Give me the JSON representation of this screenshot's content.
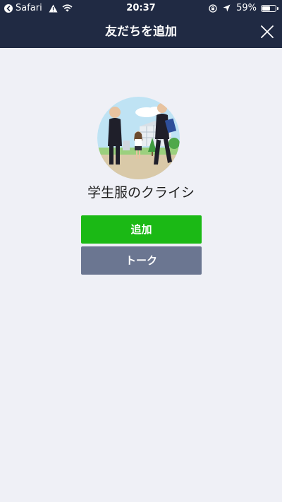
{
  "status_bar": {
    "back_app": "Safari",
    "time": "20:37",
    "battery_percent": "59%",
    "battery_level": 0.59,
    "icons": [
      "back-arrow-icon",
      "warning-icon",
      "wifi-icon",
      "orientation-lock-icon",
      "location-arrow-icon",
      "battery-icon"
    ]
  },
  "nav": {
    "title": "友だちを追加",
    "close_icon": "close-icon"
  },
  "profile": {
    "name": "学生服のクライシ",
    "avatar_description_icon": "avatar-image"
  },
  "actions": {
    "add_label": "追加",
    "talk_label": "トーク"
  },
  "colors": {
    "header_bg": "#202a43",
    "page_bg": "#eff0f6",
    "add_button": "#1bb915",
    "talk_button": "#6b7691"
  }
}
